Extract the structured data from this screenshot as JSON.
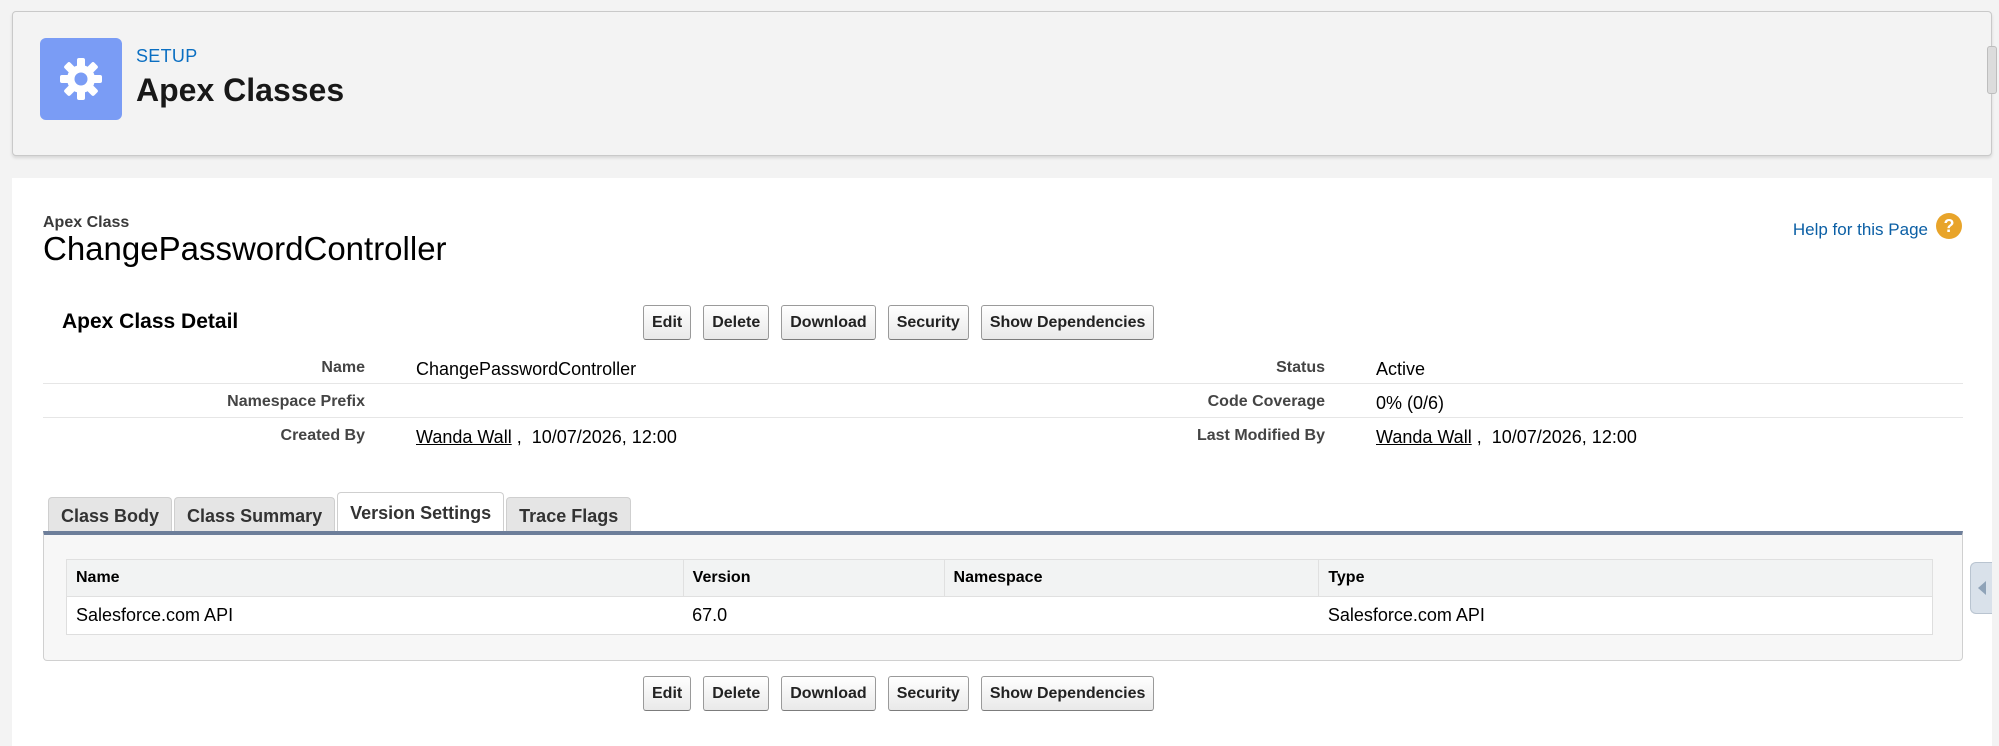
{
  "header": {
    "eyebrow": "SETUP",
    "title": "Apex Classes",
    "icon": "gear-icon",
    "icon_bg": "#7a9cf5"
  },
  "record": {
    "type_label": "Apex Class",
    "name": "ChangePasswordController",
    "help_link": "Help for this Page",
    "help_icon": "?"
  },
  "detail": {
    "section_title": "Apex Class Detail",
    "buttons": {
      "edit": "Edit",
      "delete": "Delete",
      "download": "Download",
      "security": "Security",
      "show_dependencies": "Show Dependencies"
    },
    "fields": {
      "name_label": "Name",
      "name_value": "ChangePasswordController",
      "status_label": "Status",
      "status_value": "Active",
      "namespace_label": "Namespace Prefix",
      "namespace_value": "",
      "coverage_label": "Code Coverage",
      "coverage_value": "0% (0/6)",
      "created_by_label": "Created By",
      "created_by_user": "Wanda Wall",
      "created_by_date": "10/07/2026, 12:00",
      "modified_by_label": "Last Modified By",
      "modified_by_user": "Wanda Wall",
      "modified_by_date": "10/07/2026, 12:00"
    }
  },
  "tabs": {
    "class_body": "Class Body",
    "class_summary": "Class Summary",
    "version_settings": "Version Settings",
    "trace_flags": "Trace Flags",
    "active": "Version Settings"
  },
  "version_table": {
    "headers": [
      "Name",
      "Version",
      "Namespace",
      "Type"
    ],
    "rows": [
      [
        "Salesforce.com API",
        "67.0",
        "",
        "Salesforce.com API"
      ]
    ]
  },
  "colors": {
    "link": "#0b5fa5",
    "tab_accent": "#6d7e9a",
    "help_icon": "#e8a42a"
  }
}
